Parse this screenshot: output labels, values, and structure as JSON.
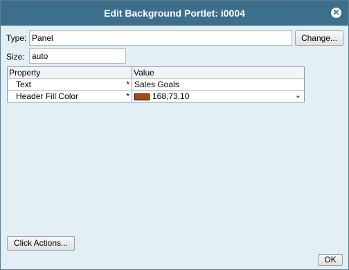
{
  "dialog": {
    "title": "Edit Background Portlet: i0004",
    "close_glyph": "✕"
  },
  "type_field": {
    "label": "Type:",
    "value": "Panel"
  },
  "change_button": {
    "label": "Change..."
  },
  "size_field": {
    "label": "Size:",
    "value": "auto"
  },
  "property_grid": {
    "headers": [
      "Property",
      "Value"
    ],
    "rows": [
      {
        "property": "Text",
        "required_mark": "*",
        "value": "Sales Goals"
      },
      {
        "property": "Header Fill Color",
        "required_mark": "*",
        "value": "168,73,10",
        "swatch_color": "#a8490a",
        "dropdown_glyph": "⌄"
      }
    ]
  },
  "click_actions_button": {
    "label": "Click Actions..."
  },
  "ok_button": {
    "label": "OK"
  },
  "colors": {
    "title_bar": "#3c6f8c",
    "dialog_bg": "#e2eff5",
    "swatch": "#a8490a"
  }
}
